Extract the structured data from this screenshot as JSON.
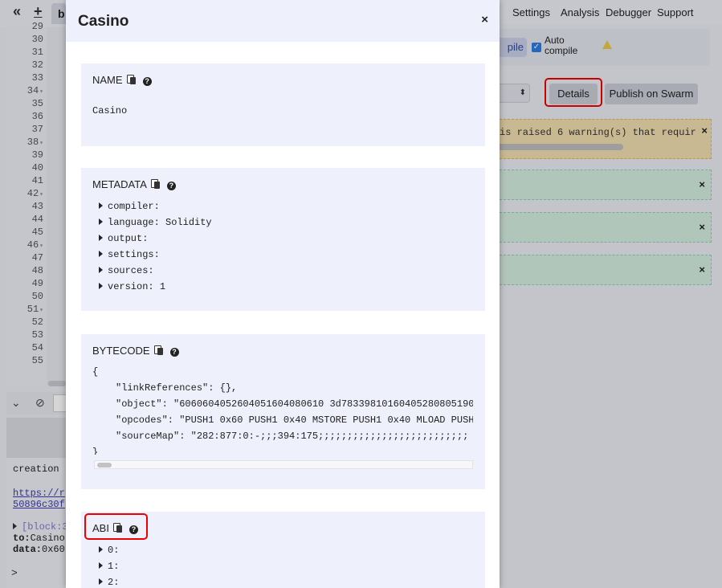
{
  "ide": {
    "collapse_icon": "«",
    "add_icon": "+",
    "tab_stub": "b",
    "line_numbers": [
      "29",
      "30",
      "31",
      "32",
      "33",
      "34",
      "35",
      "36",
      "37",
      "38",
      "39",
      "40",
      "41",
      "42",
      "43",
      "44",
      "45",
      "46",
      "47",
      "48",
      "49",
      "50",
      "51",
      "52",
      "53",
      "54",
      "55"
    ],
    "terminal": {
      "line_creation": "creation",
      "link1": "https://r",
      "link2": "50896c30f",
      "block": "[block:3",
      "to_label": "to:",
      "to_value": "Casino",
      "data_label": "data:",
      "data_value": "0x60",
      "prompt": ">"
    },
    "menu": [
      "Settings",
      "Analysis",
      "Debugger",
      "Support"
    ],
    "compile_button": "pile",
    "auto_compile": "Auto compile",
    "details_button": "Details",
    "publish_button": "Publish on Swarm",
    "warning_text": "is raised 6 warning(s) that requir",
    "close_symbol": "×"
  },
  "modal": {
    "title": "Casino",
    "close": "×",
    "name": {
      "title": "NAME",
      "value": "Casino"
    },
    "metadata": {
      "title": "METADATA",
      "items": [
        {
          "key": "compiler:",
          "value": ""
        },
        {
          "key": "language:",
          "value": "Solidity"
        },
        {
          "key": "output:",
          "value": ""
        },
        {
          "key": "settings:",
          "value": ""
        },
        {
          "key": "sources:",
          "value": ""
        },
        {
          "key": "version:",
          "value": "1"
        }
      ]
    },
    "bytecode": {
      "title": "BYTECODE",
      "open": "{",
      "lines": [
        "\"linkReferences\": {},",
        "\"object\": \"6060604052604051604080610 3d783398101604052808051906\"",
        "\"opcodes\": \"PUSH1 0x60 PUSH1 0x40 MSTORE PUSH1 0x40 MLOAD PUSH",
        "\"sourceMap\": \"282:877:0:-;;;394:175;;;;;;;;;;;;;;;;;;;;;;;;;;"
      ],
      "close": "}"
    },
    "abi": {
      "title": "ABI",
      "items": [
        "0:",
        "1:",
        "2:"
      ]
    }
  }
}
